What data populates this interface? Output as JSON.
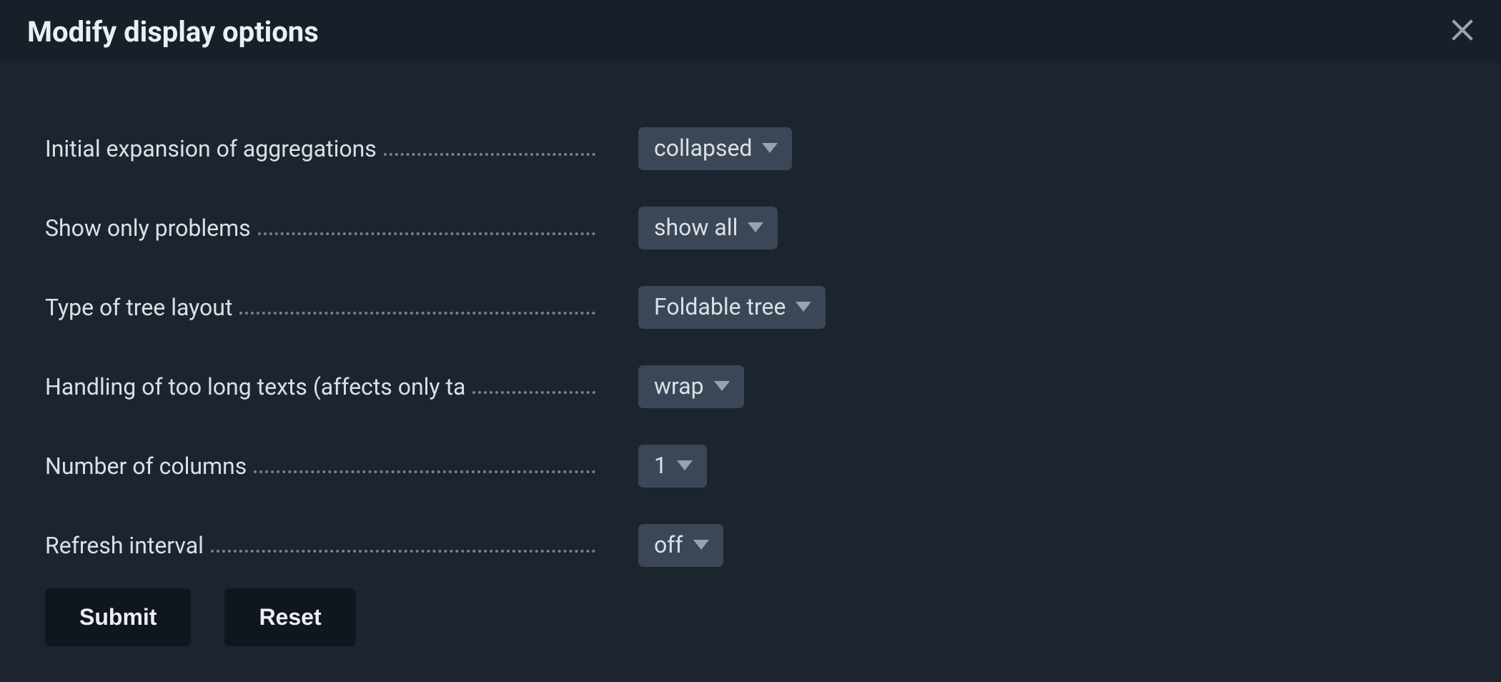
{
  "dialog": {
    "title": "Modify display options"
  },
  "form": {
    "rows": [
      {
        "label": "Initial expansion of aggregations",
        "value": "collapsed"
      },
      {
        "label": "Show only problems",
        "value": "show all"
      },
      {
        "label": "Type of tree layout",
        "value": "Foldable tree"
      },
      {
        "label": "Handling of too long texts (affects only ta",
        "value": "wrap"
      },
      {
        "label": "Number of columns",
        "value": "1"
      },
      {
        "label": "Refresh interval",
        "value": "off"
      }
    ]
  },
  "buttons": {
    "submit": "Submit",
    "reset": "Reset"
  }
}
